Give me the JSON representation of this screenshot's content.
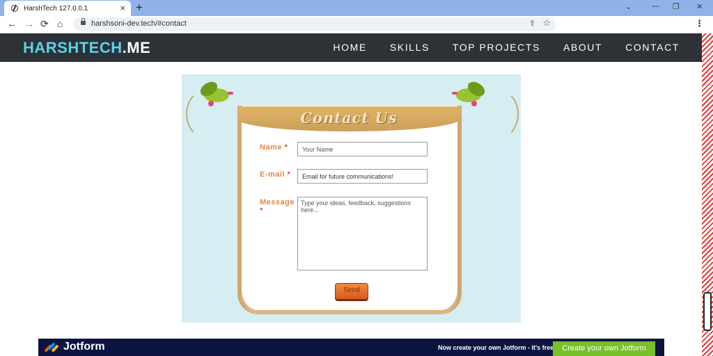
{
  "browser": {
    "tab_title": "HarshTech 127.0.0.1",
    "new_tab": "+",
    "url": "harshsoni-dev.tech/#contact",
    "back_glyph": "←",
    "forward_glyph": "→",
    "reload_glyph": "⟳",
    "home_glyph": "⌂",
    "share_glyph": "⇪",
    "star_glyph": "☆",
    "menu_glyph": "⋮",
    "minimize": "—",
    "restore": "❐",
    "close": "✕",
    "chevron": "⌄",
    "tab_close": "×"
  },
  "site": {
    "logo_part1": "HARSH",
    "logo_part2": "TECH",
    "logo_part3": ".ME",
    "nav": [
      "HOME",
      "SKILLS",
      "TOP PROJECTS",
      "ABOUT",
      "CONTACT"
    ],
    "colors": {
      "header_bg": "#2d3138",
      "logo_accent": "#5ad3e8"
    }
  },
  "form": {
    "banner_title": "Contact Us",
    "name_label": "Name",
    "email_label": "E-mail",
    "message_label": "Message",
    "required_mark": "*",
    "name_placeholder": "Your Name",
    "email_value": "Email  for future communications!",
    "message_placeholder": "Type your ideas, feedback, suggestions here...",
    "send_label": "Send"
  },
  "jotform": {
    "brand": "Jotform",
    "message": "Now create your own Jotform - It's free!",
    "cta": "Create your own Jotform"
  }
}
